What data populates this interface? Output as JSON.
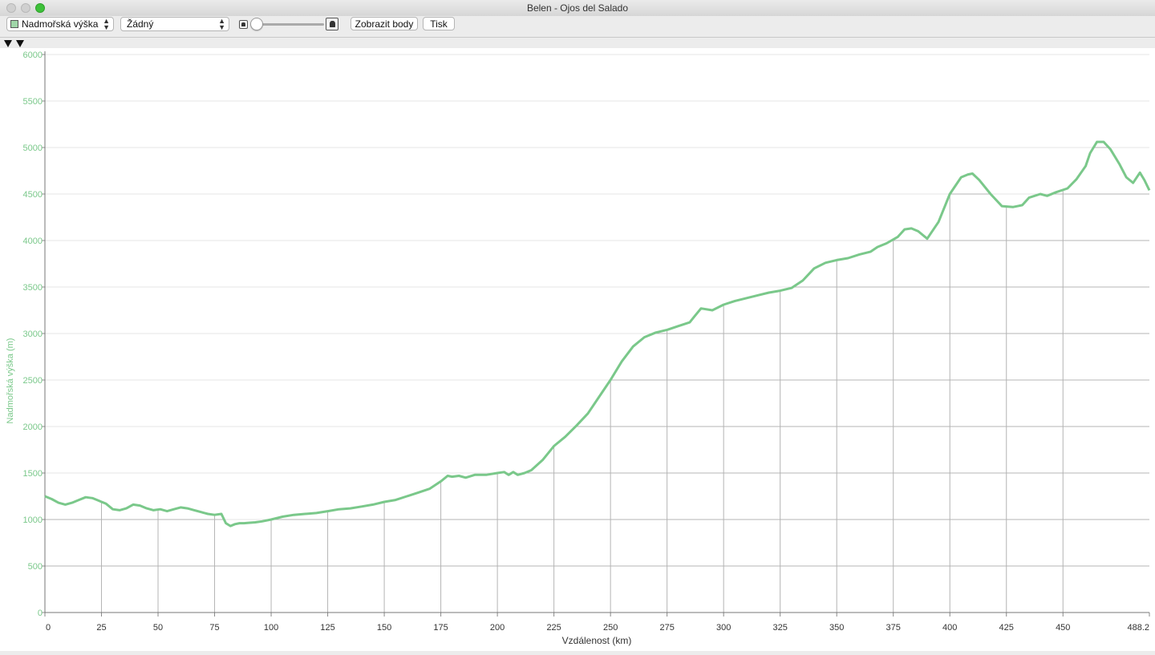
{
  "window": {
    "title": "Belen - Ojos del Salado"
  },
  "toolbar": {
    "metric_select": "Nadmořská výška",
    "second_select": "Žádný",
    "show_points_label": "Zobrazit body",
    "print_label": "Tisk"
  },
  "icons": {
    "zoom_out": "person-small-icon",
    "zoom_in": "person-large-icon",
    "marker": "triangle-marker-icon"
  },
  "colors": {
    "line": "#7ac88a",
    "axis_text": "#7ac88a",
    "grid": "#b4b4b4"
  },
  "chart_data": {
    "type": "line",
    "xlabel": "Vzdálenost (km)",
    "ylabel": "Nadmořská výška (m)",
    "xlim": [
      0,
      488.2
    ],
    "ylim": [
      0,
      6000
    ],
    "xticks": [
      0,
      25,
      50,
      75,
      100,
      125,
      150,
      175,
      200,
      225,
      250,
      275,
      300,
      325,
      350,
      375,
      400,
      425,
      450,
      488.2
    ],
    "xtick_labels": [
      "0",
      "25",
      "50",
      "75",
      "100",
      "125",
      "150",
      "175",
      "200",
      "225",
      "250",
      "275",
      "300",
      "325",
      "350",
      "375",
      "400",
      "425",
      "450",
      "488.2"
    ],
    "yticks": [
      0,
      500,
      1000,
      1500,
      2000,
      2500,
      3000,
      3500,
      4000,
      4500,
      5000,
      5500,
      6000
    ],
    "ytick_labels": [
      "0",
      "500",
      "1000",
      "1500",
      "2000",
      "2500",
      "3000",
      "3500",
      "4000",
      "4500",
      "5000",
      "5500",
      "6000"
    ],
    "series": [
      {
        "x": [
          0,
          3,
          6,
          9,
          12,
          15,
          18,
          21,
          24,
          27,
          30,
          33,
          36,
          39,
          42,
          45,
          48,
          51,
          54,
          57,
          60,
          63,
          66,
          69,
          72,
          75,
          78,
          80,
          82,
          84,
          86,
          88,
          90,
          93,
          96,
          100,
          105,
          110,
          115,
          120,
          125,
          130,
          135,
          140,
          145,
          150,
          155,
          160,
          165,
          170,
          175,
          178,
          180,
          183,
          186,
          190,
          195,
          200,
          203,
          205,
          207,
          209,
          212,
          215,
          220,
          225,
          230,
          235,
          240,
          245,
          250,
          255,
          260,
          265,
          270,
          275,
          280,
          285,
          287,
          290,
          295,
          300,
          305,
          310,
          315,
          320,
          325,
          330,
          335,
          340,
          345,
          350,
          355,
          360,
          365,
          368,
          372,
          377,
          380,
          383,
          386,
          390,
          395,
          400,
          405,
          408,
          410,
          413,
          418,
          423,
          428,
          432,
          435,
          440,
          443,
          447,
          452,
          456,
          460,
          462,
          465,
          468,
          471,
          475,
          478,
          481,
          484,
          486,
          488.2
        ],
        "y": [
          1250,
          1220,
          1180,
          1160,
          1180,
          1210,
          1240,
          1230,
          1200,
          1170,
          1110,
          1100,
          1120,
          1160,
          1150,
          1120,
          1100,
          1110,
          1090,
          1110,
          1130,
          1120,
          1100,
          1080,
          1060,
          1050,
          1060,
          960,
          930,
          950,
          960,
          960,
          965,
          970,
          980,
          1000,
          1030,
          1050,
          1060,
          1070,
          1090,
          1110,
          1120,
          1140,
          1160,
          1190,
          1210,
          1250,
          1290,
          1330,
          1410,
          1470,
          1460,
          1470,
          1450,
          1480,
          1480,
          1500,
          1510,
          1480,
          1510,
          1480,
          1500,
          1530,
          1640,
          1790,
          1890,
          2010,
          2140,
          2320,
          2500,
          2700,
          2860,
          2960,
          3010,
          3040,
          3080,
          3120,
          3180,
          3270,
          3250,
          3310,
          3350,
          3380,
          3410,
          3440,
          3460,
          3490,
          3570,
          3700,
          3760,
          3790,
          3810,
          3850,
          3880,
          3930,
          3970,
          4040,
          4120,
          4130,
          4100,
          4020,
          4200,
          4500,
          4680,
          4710,
          4720,
          4650,
          4500,
          4370,
          4360,
          4380,
          4460,
          4500,
          4480,
          4520,
          4560,
          4660,
          4800,
          4940,
          5060,
          5060,
          4980,
          4820,
          4680,
          4620,
          4730,
          4650,
          4540
        ],
        "values_note": ""
      }
    ]
  }
}
